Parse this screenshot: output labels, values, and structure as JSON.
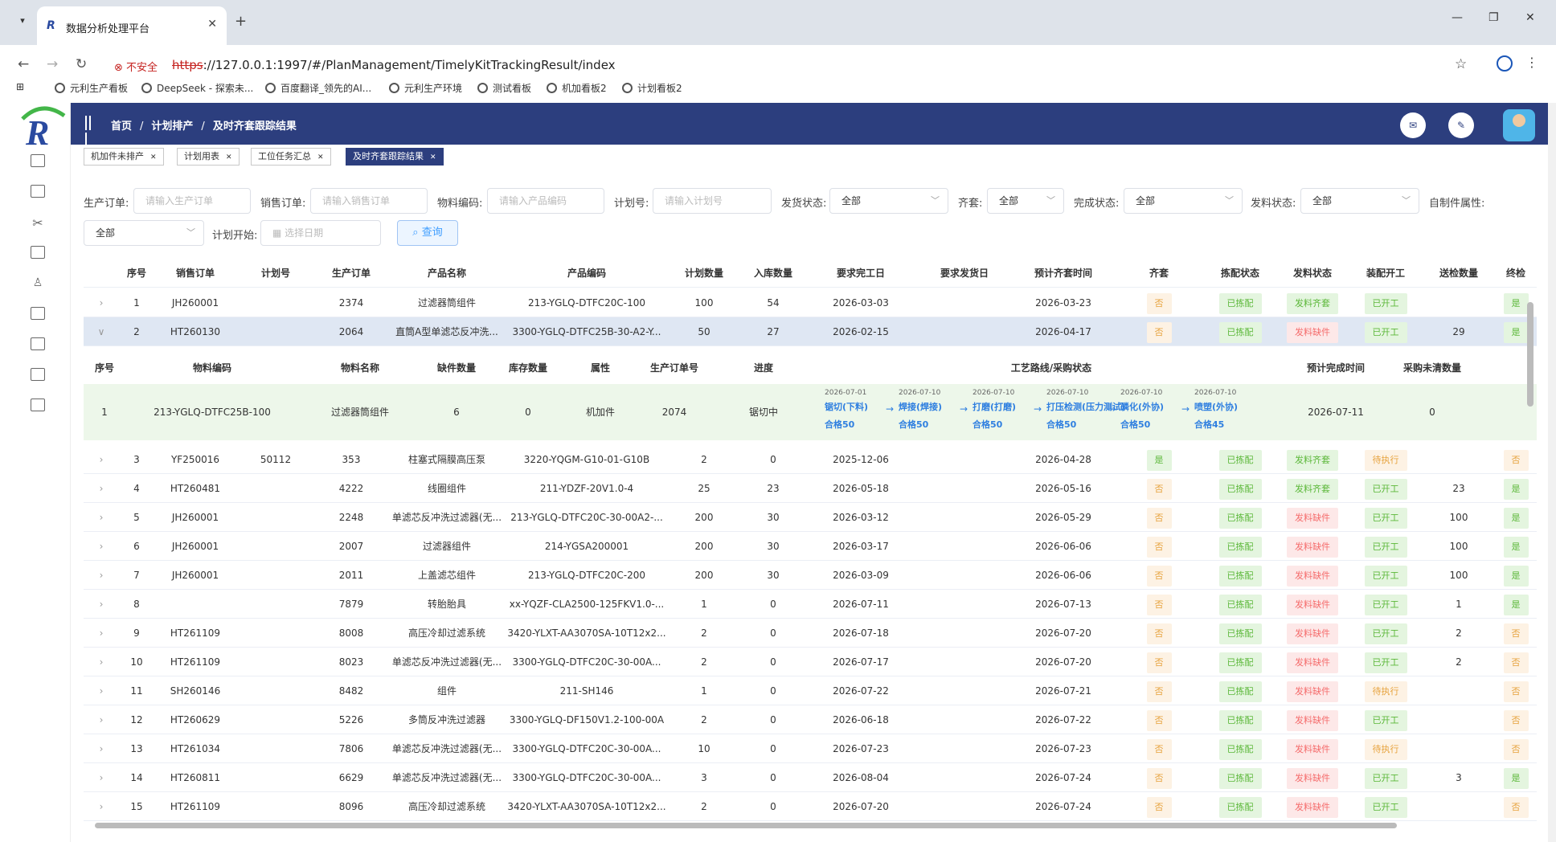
{
  "browser": {
    "tab_title": "数据分析处理平台",
    "favicon_text": "R",
    "unsafe_label": "不安全",
    "url_scheme": "https",
    "url_rest": "://127.0.0.1:1997/#/PlanManagement/TimelyKitTrackingResult/index",
    "bookmarks": [
      "元利生产看板",
      "DeepSeek - 探索未...",
      "百度翻译_领先的AI...",
      "元利生产环境",
      "测试看板",
      "机加看板2",
      "计划看板2"
    ]
  },
  "header": {
    "breadcrumb": [
      "首页",
      "计划排产",
      "及时齐套跟踪结果"
    ]
  },
  "tags": [
    {
      "label": "机加件未排产"
    },
    {
      "label": "计划用表"
    },
    {
      "label": "工位任务汇总"
    },
    {
      "label": "及时齐套跟踪结果"
    }
  ],
  "filters": {
    "prod_order_label": "生产订单:",
    "prod_order_ph": "请输入生产订单",
    "sales_order_label": "销售订单:",
    "sales_order_ph": "请输入销售订单",
    "material_label": "物料编码:",
    "material_ph": "请输入产品编码",
    "plan_no_label": "计划号:",
    "plan_no_ph": "请输入计划号",
    "ship_label": "发货状态:",
    "ship_value": "全部",
    "kit_label": "齐套:",
    "kit_value": "全部",
    "done_label": "完成状态:",
    "done_value": "全部",
    "issue_label": "发料状态:",
    "issue_value": "全部",
    "self_label": "自制件属性:",
    "self_value": "全部",
    "plan_start_label": "计划开始:",
    "plan_start_ph": "选择日期",
    "query_label": "查询"
  },
  "table": {
    "headers": [
      "序号",
      "销售订单",
      "计划号",
      "生产订单",
      "产品名称",
      "产品编码",
      "计划数量",
      "入库数量",
      "要求完工日",
      "要求发货日",
      "预计齐套时间",
      "齐套",
      "拣配状态",
      "发料状态",
      "装配开工",
      "送检数量",
      "终检"
    ],
    "rows": [
      {
        "no": "1",
        "so": "JH260001",
        "plan": "",
        "po": "2374",
        "name": "过滤器筒组件",
        "code": "213-YGLQ-DTFC20C-100",
        "qty": "100",
        "in": "54",
        "due": "2026-03-03",
        "ship": "",
        "eta": "2026-03-23",
        "kit": "否",
        "pick": "已拣配",
        "issue": "发料齐套",
        "asm": "已开工",
        "insp": "",
        "fin": "是"
      },
      {
        "no": "2",
        "so": "HT260130",
        "plan": "",
        "po": "2064",
        "name": "直筒A型单滤芯反冲洗...",
        "code": "3300-YGLQ-DTFC25B-30-A2-Y...",
        "qty": "50",
        "in": "27",
        "due": "2026-02-15",
        "ship": "",
        "eta": "2026-04-17",
        "kit": "否",
        "pick": "已拣配",
        "issue": "发料缺件",
        "asm": "已开工",
        "insp": "29",
        "fin": "是"
      },
      {
        "no": "3",
        "so": "YF250016",
        "plan": "50112",
        "po": "353",
        "name": "柱塞式隔膜高压泵",
        "code": "3220-YQGM-G10-01-G10B",
        "qty": "2",
        "in": "0",
        "due": "2025-12-06",
        "ship": "",
        "eta": "2026-04-28",
        "kit": "是",
        "pick": "已拣配",
        "issue": "发料齐套",
        "asm": "待执行",
        "insp": "",
        "fin": "否"
      },
      {
        "no": "4",
        "so": "HT260481",
        "plan": "",
        "po": "4222",
        "name": "线圈组件",
        "code": "211-YDZF-20V1.0-4",
        "qty": "25",
        "in": "23",
        "due": "2026-05-18",
        "ship": "",
        "eta": "2026-05-16",
        "kit": "否",
        "pick": "已拣配",
        "issue": "发料齐套",
        "asm": "已开工",
        "insp": "23",
        "fin": "是"
      },
      {
        "no": "5",
        "so": "JH260001",
        "plan": "",
        "po": "2248",
        "name": "单滤芯反冲洗过滤器(无...",
        "code": "213-YGLQ-DTFC20C-30-00A2-...",
        "qty": "200",
        "in": "30",
        "due": "2026-03-12",
        "ship": "",
        "eta": "2026-05-29",
        "kit": "否",
        "pick": "已拣配",
        "issue": "发料缺件",
        "asm": "已开工",
        "insp": "100",
        "fin": "是"
      },
      {
        "no": "6",
        "so": "JH260001",
        "plan": "",
        "po": "2007",
        "name": "过滤器组件",
        "code": "214-YGSA200001",
        "qty": "200",
        "in": "30",
        "due": "2026-03-17",
        "ship": "",
        "eta": "2026-06-06",
        "kit": "否",
        "pick": "已拣配",
        "issue": "发料缺件",
        "asm": "已开工",
        "insp": "100",
        "fin": "是"
      },
      {
        "no": "7",
        "so": "JH260001",
        "plan": "",
        "po": "2011",
        "name": "上盖滤芯组件",
        "code": "213-YGLQ-DTFC20C-200",
        "qty": "200",
        "in": "30",
        "due": "2026-03-09",
        "ship": "",
        "eta": "2026-06-06",
        "kit": "否",
        "pick": "已拣配",
        "issue": "发料缺件",
        "asm": "已开工",
        "insp": "100",
        "fin": "是"
      },
      {
        "no": "8",
        "so": "",
        "plan": "",
        "po": "7879",
        "name": "转胎胎具",
        "code": "xx-YQZF-CLA2500-125FKV1.0-...",
        "qty": "1",
        "in": "0",
        "due": "2026-07-11",
        "ship": "",
        "eta": "2026-07-13",
        "kit": "否",
        "pick": "已拣配",
        "issue": "发料缺件",
        "asm": "已开工",
        "insp": "1",
        "fin": "是"
      },
      {
        "no": "9",
        "so": "HT261109",
        "plan": "",
        "po": "8008",
        "name": "高压冷却过滤系统",
        "code": "3420-YLXT-AA3070SA-10T12x2...",
        "qty": "2",
        "in": "0",
        "due": "2026-07-18",
        "ship": "",
        "eta": "2026-07-20",
        "kit": "否",
        "pick": "已拣配",
        "issue": "发料缺件",
        "asm": "已开工",
        "insp": "2",
        "fin": "否"
      },
      {
        "no": "10",
        "so": "HT261109",
        "plan": "",
        "po": "8023",
        "name": "单滤芯反冲洗过滤器(无...",
        "code": "3300-YGLQ-DTFC20C-30-00A...",
        "qty": "2",
        "in": "0",
        "due": "2026-07-17",
        "ship": "",
        "eta": "2026-07-20",
        "kit": "否",
        "pick": "已拣配",
        "issue": "发料缺件",
        "asm": "已开工",
        "insp": "2",
        "fin": "否"
      },
      {
        "no": "11",
        "so": "SH260146",
        "plan": "",
        "po": "8482",
        "name": "组件",
        "code": "211-SH146",
        "qty": "1",
        "in": "0",
        "due": "2026-07-22",
        "ship": "",
        "eta": "2026-07-21",
        "kit": "否",
        "pick": "已拣配",
        "issue": "发料缺件",
        "asm": "待执行",
        "insp": "",
        "fin": "否"
      },
      {
        "no": "12",
        "so": "HT260629",
        "plan": "",
        "po": "5226",
        "name": "多筒反冲洗过滤器",
        "code": "3300-YGLQ-DF150V1.2-100-00A",
        "qty": "2",
        "in": "0",
        "due": "2026-06-18",
        "ship": "",
        "eta": "2026-07-22",
        "kit": "否",
        "pick": "已拣配",
        "issue": "发料缺件",
        "asm": "已开工",
        "insp": "",
        "fin": "否"
      },
      {
        "no": "13",
        "so": "HT261034",
        "plan": "",
        "po": "7806",
        "name": "单滤芯反冲洗过滤器(无...",
        "code": "3300-YGLQ-DTFC20C-30-00A...",
        "qty": "10",
        "in": "0",
        "due": "2026-07-23",
        "ship": "",
        "eta": "2026-07-23",
        "kit": "否",
        "pick": "已拣配",
        "issue": "发料缺件",
        "asm": "待执行",
        "insp": "",
        "fin": "否"
      },
      {
        "no": "14",
        "so": "HT260811",
        "plan": "",
        "po": "6629",
        "name": "单滤芯反冲洗过滤器(无...",
        "code": "3300-YGLQ-DTFC20C-30-00A...",
        "qty": "3",
        "in": "0",
        "due": "2026-08-04",
        "ship": "",
        "eta": "2026-07-24",
        "kit": "否",
        "pick": "已拣配",
        "issue": "发料缺件",
        "asm": "已开工",
        "insp": "3",
        "fin": "是"
      },
      {
        "no": "15",
        "so": "HT261109",
        "plan": "",
        "po": "8096",
        "name": "高压冷却过滤系统",
        "code": "3420-YLXT-AA3070SA-10T12x2...",
        "qty": "2",
        "in": "0",
        "due": "2026-07-20",
        "ship": "",
        "eta": "2026-07-24",
        "kit": "否",
        "pick": "已拣配",
        "issue": "发料缺件",
        "asm": "已开工",
        "insp": "",
        "fin": "否"
      }
    ]
  },
  "subtable": {
    "headers": [
      "序号",
      "物料编码",
      "物料名称",
      "缺件数量",
      "库存数量",
      "属性",
      "生产订单号",
      "进度",
      "工艺路线/采购状态",
      "预计完成时间",
      "采购未清数量"
    ],
    "row": {
      "no": "1",
      "code": "213-YGLQ-DTFC25B-100",
      "name": "过滤器筒组件",
      "short": "6",
      "stock": "0",
      "attr": "机加件",
      "po": "2074",
      "progress": "锯切中",
      "eta": "2026-07-11",
      "open": "0"
    },
    "steps": [
      {
        "date": "2026-07-01",
        "name": "锯切(下料)",
        "qty": "合格50"
      },
      {
        "date": "2026-07-10",
        "name": "焊接(焊接)",
        "qty": "合格50"
      },
      {
        "date": "2026-07-10",
        "name": "打磨(打磨)",
        "qty": "合格50"
      },
      {
        "date": "2026-07-10",
        "name": "打压检测(压力测试)",
        "qty": "合格50"
      },
      {
        "date": "2026-07-10",
        "name": "磷化(外协)",
        "qty": "合格50"
      },
      {
        "date": "2026-07-10",
        "name": "喷塑(外协)",
        "qty": "合格45"
      }
    ]
  }
}
